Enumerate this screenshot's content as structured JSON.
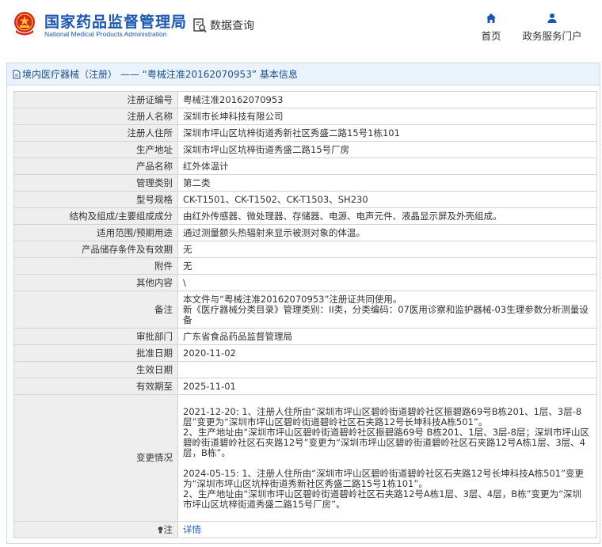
{
  "header": {
    "logo_cn": "国家药品监督管理局",
    "logo_en": "National Medical Products Administration",
    "query_label": "数据查询",
    "nav": [
      {
        "label": "首页",
        "icon": "home-icon"
      },
      {
        "label": "政务服务门户",
        "icon": "user-icon"
      }
    ]
  },
  "panel": {
    "title": "境内医疗器械（注册） —— “粤械注准20162070953” 基本信息"
  },
  "rows": [
    {
      "label": "注册证编号",
      "value": "粤械注准20162070953"
    },
    {
      "label": "注册人名称",
      "value": "深圳市长坤科技有限公司"
    },
    {
      "label": "注册人住所",
      "value": "深圳市坪山区坑梓街道秀新社区秀盛二路15号1栋101"
    },
    {
      "label": "生产地址",
      "value": "深圳市坪山区坑梓街道秀盛二路15号厂房"
    },
    {
      "label": "产品名称",
      "value": "红外体温计"
    },
    {
      "label": "管理类别",
      "value": "第二类"
    },
    {
      "label": "型号规格",
      "value": "CK-T1501、CK-T1502、CK-T1503、SH230"
    },
    {
      "label": "结构及组成/主要组成成分",
      "value": "由红外传感器、微处理器、存储器、电源、电声元件、液晶显示屏及外壳组成。"
    },
    {
      "label": "适用范围/预期用途",
      "value": "通过测量额头热辐射来显示被测对象的体温。"
    },
    {
      "label": "产品储存条件及有效期",
      "value": "无"
    },
    {
      "label": "附件",
      "value": "无"
    },
    {
      "label": "其他内容",
      "value": "\\"
    },
    {
      "label": "备注",
      "value": "本文件与“粤械注准20162070953”注册证共同使用。\n新《医疗器械分类目录》管理类别：II类，分类编码：07医用诊察和监护器械-03生理参数分析测量设备"
    },
    {
      "label": "审批部门",
      "value": "广东省食品药品监督管理局"
    },
    {
      "label": "批准日期",
      "value": "2020-11-02"
    },
    {
      "label": "生效日期",
      "value": ""
    },
    {
      "label": "有效期至",
      "value": "2025-11-01"
    },
    {
      "label": "变更情况",
      "value": "2021-12-20: 1、注册人住所由“深圳市坪山区碧岭街道碧岭社区振碧路69号B栋201、1层、3层-8层”变更为“深圳市坪山区碧岭街道碧岭社区石夹路12号长坤科技A栋501”。\n2、生产地址由“深圳市坪山区碧岭街道碧岭社区振碧路69号 B栋201、1层、3层-8层；深圳市坪山区碧岭街道碧岭社区石夹路12号”变更为“深圳市坪山区碧岭街道碧岭社区石夹路12号A栋1层、3层、4层，B栋”。\n\n2024-05-15: 1、注册人住所由“深圳市坪山区碧岭街道碧岭社区石夹路12号长坤科技A栋501”变更为“深圳市坪山区坑梓街道秀新社区秀盛二路15号1栋101”。\n2、生产地址由“深圳市坪山区碧岭街道碧岭社区石夹路12号A栋1层、3层、4层，B栋”变更为“深圳市坪山区坑梓街道秀盛二路15号厂房”。"
    }
  ],
  "note": {
    "label": "注",
    "link": "详情"
  }
}
